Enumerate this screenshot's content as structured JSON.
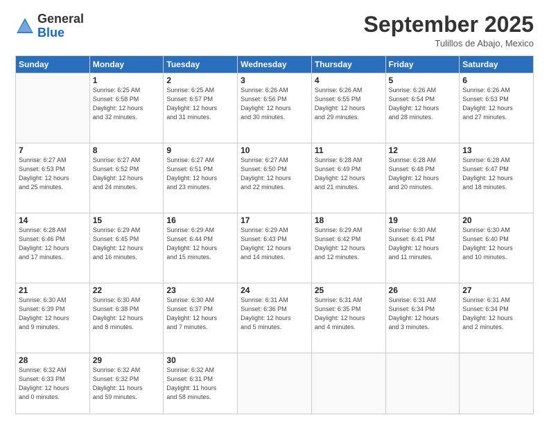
{
  "logo": {
    "general": "General",
    "blue": "Blue"
  },
  "header": {
    "month": "September 2025",
    "location": "Tulillos de Abajo, Mexico"
  },
  "weekdays": [
    "Sunday",
    "Monday",
    "Tuesday",
    "Wednesday",
    "Thursday",
    "Friday",
    "Saturday"
  ],
  "weeks": [
    [
      {
        "day": "",
        "info": ""
      },
      {
        "day": "1",
        "info": "Sunrise: 6:25 AM\nSunset: 6:58 PM\nDaylight: 12 hours\nand 32 minutes."
      },
      {
        "day": "2",
        "info": "Sunrise: 6:25 AM\nSunset: 6:57 PM\nDaylight: 12 hours\nand 31 minutes."
      },
      {
        "day": "3",
        "info": "Sunrise: 6:26 AM\nSunset: 6:56 PM\nDaylight: 12 hours\nand 30 minutes."
      },
      {
        "day": "4",
        "info": "Sunrise: 6:26 AM\nSunset: 6:55 PM\nDaylight: 12 hours\nand 29 minutes."
      },
      {
        "day": "5",
        "info": "Sunrise: 6:26 AM\nSunset: 6:54 PM\nDaylight: 12 hours\nand 28 minutes."
      },
      {
        "day": "6",
        "info": "Sunrise: 6:26 AM\nSunset: 6:53 PM\nDaylight: 12 hours\nand 27 minutes."
      }
    ],
    [
      {
        "day": "7",
        "info": "Sunrise: 6:27 AM\nSunset: 6:53 PM\nDaylight: 12 hours\nand 25 minutes."
      },
      {
        "day": "8",
        "info": "Sunrise: 6:27 AM\nSunset: 6:52 PM\nDaylight: 12 hours\nand 24 minutes."
      },
      {
        "day": "9",
        "info": "Sunrise: 6:27 AM\nSunset: 6:51 PM\nDaylight: 12 hours\nand 23 minutes."
      },
      {
        "day": "10",
        "info": "Sunrise: 6:27 AM\nSunset: 6:50 PM\nDaylight: 12 hours\nand 22 minutes."
      },
      {
        "day": "11",
        "info": "Sunrise: 6:28 AM\nSunset: 6:49 PM\nDaylight: 12 hours\nand 21 minutes."
      },
      {
        "day": "12",
        "info": "Sunrise: 6:28 AM\nSunset: 6:48 PM\nDaylight: 12 hours\nand 20 minutes."
      },
      {
        "day": "13",
        "info": "Sunrise: 6:28 AM\nSunset: 6:47 PM\nDaylight: 12 hours\nand 18 minutes."
      }
    ],
    [
      {
        "day": "14",
        "info": "Sunrise: 6:28 AM\nSunset: 6:46 PM\nDaylight: 12 hours\nand 17 minutes."
      },
      {
        "day": "15",
        "info": "Sunrise: 6:29 AM\nSunset: 6:45 PM\nDaylight: 12 hours\nand 16 minutes."
      },
      {
        "day": "16",
        "info": "Sunrise: 6:29 AM\nSunset: 6:44 PM\nDaylight: 12 hours\nand 15 minutes."
      },
      {
        "day": "17",
        "info": "Sunrise: 6:29 AM\nSunset: 6:43 PM\nDaylight: 12 hours\nand 14 minutes."
      },
      {
        "day": "18",
        "info": "Sunrise: 6:29 AM\nSunset: 6:42 PM\nDaylight: 12 hours\nand 12 minutes."
      },
      {
        "day": "19",
        "info": "Sunrise: 6:30 AM\nSunset: 6:41 PM\nDaylight: 12 hours\nand 11 minutes."
      },
      {
        "day": "20",
        "info": "Sunrise: 6:30 AM\nSunset: 6:40 PM\nDaylight: 12 hours\nand 10 minutes."
      }
    ],
    [
      {
        "day": "21",
        "info": "Sunrise: 6:30 AM\nSunset: 6:39 PM\nDaylight: 12 hours\nand 9 minutes."
      },
      {
        "day": "22",
        "info": "Sunrise: 6:30 AM\nSunset: 6:38 PM\nDaylight: 12 hours\nand 8 minutes."
      },
      {
        "day": "23",
        "info": "Sunrise: 6:30 AM\nSunset: 6:37 PM\nDaylight: 12 hours\nand 7 minutes."
      },
      {
        "day": "24",
        "info": "Sunrise: 6:31 AM\nSunset: 6:36 PM\nDaylight: 12 hours\nand 5 minutes."
      },
      {
        "day": "25",
        "info": "Sunrise: 6:31 AM\nSunset: 6:35 PM\nDaylight: 12 hours\nand 4 minutes."
      },
      {
        "day": "26",
        "info": "Sunrise: 6:31 AM\nSunset: 6:34 PM\nDaylight: 12 hours\nand 3 minutes."
      },
      {
        "day": "27",
        "info": "Sunrise: 6:31 AM\nSunset: 6:34 PM\nDaylight: 12 hours\nand 2 minutes."
      }
    ],
    [
      {
        "day": "28",
        "info": "Sunrise: 6:32 AM\nSunset: 6:33 PM\nDaylight: 12 hours\nand 0 minutes."
      },
      {
        "day": "29",
        "info": "Sunrise: 6:32 AM\nSunset: 6:32 PM\nDaylight: 11 hours\nand 59 minutes."
      },
      {
        "day": "30",
        "info": "Sunrise: 6:32 AM\nSunset: 6:31 PM\nDaylight: 11 hours\nand 58 minutes."
      },
      {
        "day": "",
        "info": ""
      },
      {
        "day": "",
        "info": ""
      },
      {
        "day": "",
        "info": ""
      },
      {
        "day": "",
        "info": ""
      }
    ]
  ]
}
